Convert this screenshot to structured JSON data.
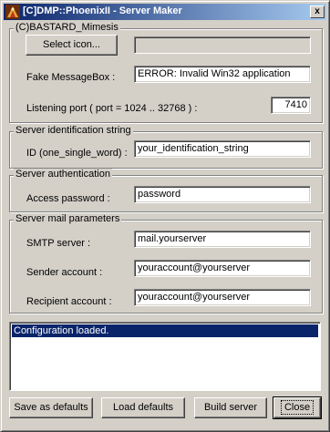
{
  "window": {
    "title": "[C]DMP::PhoenixII - Server Maker",
    "close_glyph": "x"
  },
  "groups": {
    "mimesis": {
      "label": "(C)BASTARD_Mimesis",
      "select_icon_button": "Select icon...",
      "icon_path_value": "",
      "fake_messagebox_label": "Fake MessageBox :",
      "fake_messagebox_value": "ERROR: Invalid Win32 application",
      "listening_port_label": "Listening port   ( port = 1024 .. 32768 ) :",
      "listening_port_value": "7410"
    },
    "identification": {
      "label": "Server identification string",
      "id_label": "ID (one_single_word) :",
      "id_value": "your_identification_string"
    },
    "authentication": {
      "label": "Server authentication",
      "password_label": "Access password :",
      "password_value": "password"
    },
    "mail": {
      "label": "Server mail parameters",
      "smtp_label": "SMTP server :",
      "smtp_value": "mail.yourserver",
      "sender_label": "Sender account :",
      "sender_value": "youraccount@yourserver",
      "recipient_label": "Recipient account :",
      "recipient_value": "youraccount@yourserver"
    }
  },
  "log": {
    "lines": [
      "Configuration loaded."
    ]
  },
  "buttons": {
    "save_defaults": "Save as defaults",
    "load_defaults": "Load defaults",
    "build_server": "Build server",
    "close": "Close"
  },
  "colors": {
    "titlebar_start": "#0a246a",
    "titlebar_end": "#a6caf0",
    "face": "#d4d0c8",
    "selection": "#0a246a"
  },
  "icons": {
    "app_icon": "app-icon",
    "close_icon": "close-icon"
  }
}
